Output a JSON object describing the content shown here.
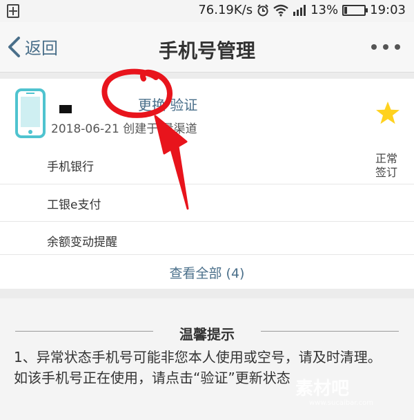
{
  "status_bar": {
    "speed": "76.19K/s",
    "battery_percent": "13%",
    "battery_level": 0.13,
    "time": "19:03",
    "icons": [
      "alarm-icon",
      "wifi-icon",
      "signal-icon",
      "battery-icon"
    ]
  },
  "nav": {
    "back_label": "返回",
    "title": "手机号管理"
  },
  "card": {
    "change_link": "更换 验证",
    "create_info": "2018-06-21 创建于 量渠道",
    "status_line1": "正常",
    "status_line2": "签订",
    "services": [
      "手机银行",
      "工银e支付",
      "余额变动提醒"
    ],
    "view_all": "查看全部 (4)"
  },
  "tips": {
    "title": "温馨提示",
    "body": "1、异常状态手机号可能非您本人使用或空号，请及时清理。如该手机号正在使用，请点击“验证”更新状态"
  },
  "watermark": {
    "text": "素材吧",
    "sub": "www.sucaibar.com"
  },
  "colors": {
    "accent": "#4a6f8a",
    "phone_icon": "#4fc3cf",
    "star": "#ffd21f",
    "annotation": "#e8141c"
  }
}
